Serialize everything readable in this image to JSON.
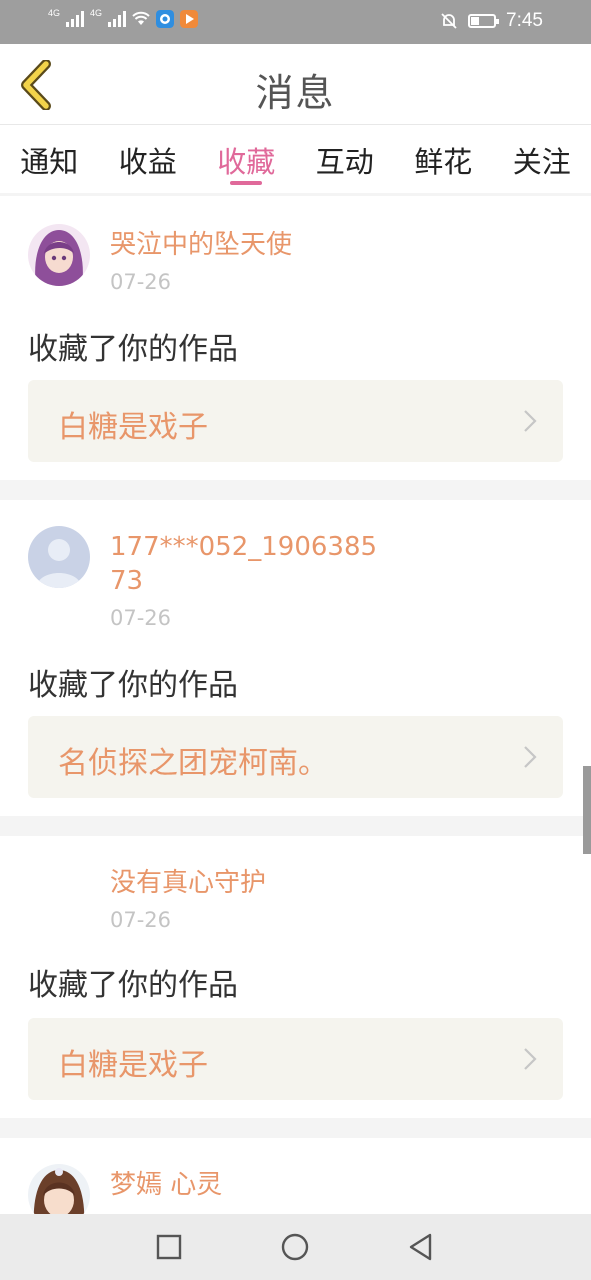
{
  "status_bar": {
    "net1": "4G",
    "net2": "4G",
    "time": "7:45",
    "battery_level": 0.35
  },
  "header": {
    "title": "消息"
  },
  "tabs": [
    {
      "label": "通知",
      "active": false
    },
    {
      "label": "收益",
      "active": false
    },
    {
      "label": "收藏",
      "active": true
    },
    {
      "label": "互动",
      "active": false
    },
    {
      "label": "鲜花",
      "active": false
    },
    {
      "label": "关注",
      "active": false
    }
  ],
  "items": [
    {
      "user": "哭泣中的坠天使",
      "date": "07-26",
      "action": "收藏了你的作品",
      "work": "白糖是戏子",
      "avatar": "anime-girl-purple"
    },
    {
      "user": "177***052_190638573",
      "date": "07-26",
      "action": "收藏了你的作品",
      "work": "名侦探之团宠柯南。",
      "avatar": "default-avatar"
    },
    {
      "user": "没有真心守护",
      "date": "07-26",
      "action": "收藏了你的作品",
      "work": "白糖是戏子",
      "avatar": "none"
    },
    {
      "user": "梦嫣 心灵",
      "date": "",
      "action": "",
      "work": "",
      "avatar": "anime-girl-brown"
    }
  ],
  "colors": {
    "accent": "#e0699a",
    "username": "#e8966a",
    "date": "#c4c4c4",
    "card_bg": "#f5f4ee",
    "separator": "#f4f4f4",
    "status_bar": "#9e9e9e"
  }
}
